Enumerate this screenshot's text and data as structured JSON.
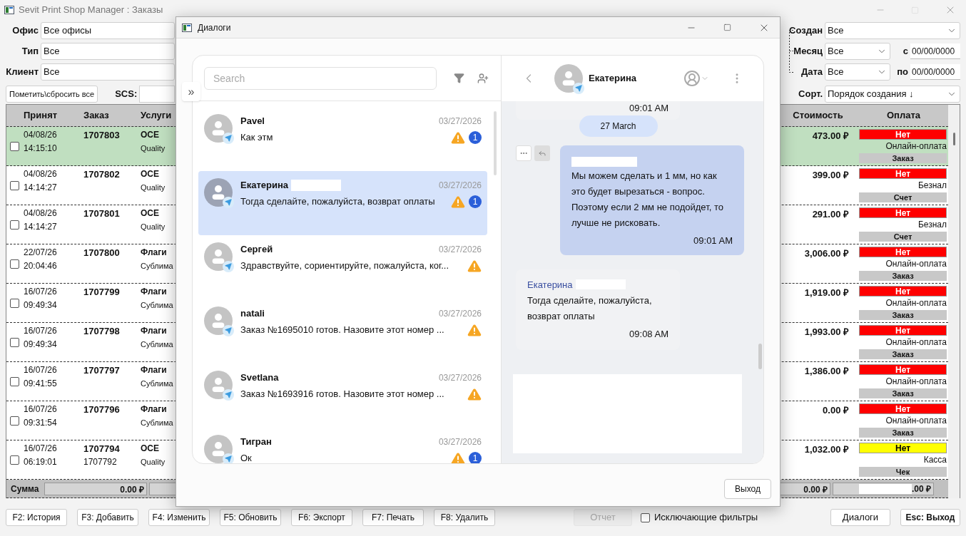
{
  "window": {
    "title": "Sevit Print Shop Manager : Заказы"
  },
  "filters_left": [
    {
      "label": "Офис",
      "value": "Все офисы"
    },
    {
      "label": "Тип",
      "value": "Все"
    },
    {
      "label": "Клиент",
      "value": "Все"
    }
  ],
  "mark_all_button": "Пометить\\сбросить все",
  "scs": {
    "label": "SCS:"
  },
  "filters_right": {
    "created": {
      "label": "Создан",
      "value": "Все"
    },
    "month": {
      "label": "Месяц",
      "value": "Все"
    },
    "date": {
      "label": "Дата",
      "value": "Все"
    },
    "from": {
      "label": "с",
      "value": "00/00/0000"
    },
    "to": {
      "label": "по",
      "value": "00/00/0000"
    },
    "sort": {
      "label": "Сорт.",
      "value": "Порядок создания ↓"
    }
  },
  "table": {
    "columns": [
      "Принят",
      "Заказ",
      "Услуги",
      "Стоимость",
      "Оплата"
    ],
    "rows": [
      {
        "selected": true,
        "checked": false,
        "date": "04/08/26",
        "time": "14:15:10",
        "order": "1707803",
        "service": "OCE",
        "service_sub": "Quality",
        "cost": "473.00 ₽",
        "status": "Нет",
        "color": "#ff0000",
        "method": "Онлайн-оплата",
        "doc": "Заказ"
      },
      {
        "selected": false,
        "checked": false,
        "date": "04/08/26",
        "time": "14:14:27",
        "order": "1707802",
        "service": "OCE",
        "service_sub": "Quality",
        "cost": "399.00 ₽",
        "status": "Нет",
        "color": "#ff0000",
        "method": "Безнал",
        "doc": "Счет"
      },
      {
        "selected": false,
        "checked": false,
        "date": "04/08/26",
        "time": "14:14:27",
        "order": "1707801",
        "service": "OCE",
        "service_sub": "Quality",
        "cost": "291.00 ₽",
        "status": "Нет",
        "color": "#ff0000",
        "method": "Безнал",
        "doc": "Счет"
      },
      {
        "selected": false,
        "checked": false,
        "date": "22/07/26",
        "time": "20:04:46",
        "order": "1707800",
        "service": "Флаги",
        "service_sub": "Сублима",
        "cost": "3,006.00 ₽",
        "status": "Нет",
        "color": "#ff0000",
        "method": "Онлайн-оплата",
        "doc": "Заказ"
      },
      {
        "selected": false,
        "checked": false,
        "date": "16/07/26",
        "time": "09:49:34",
        "order": "1707799",
        "service": "Флаги",
        "service_sub": "Сублима",
        "cost": "1,919.00 ₽",
        "status": "Нет",
        "color": "#ff0000",
        "method": "Онлайн-оплата",
        "doc": "Заказ"
      },
      {
        "selected": false,
        "checked": false,
        "date": "16/07/26",
        "time": "09:49:34",
        "order": "1707798",
        "service": "Флаги",
        "service_sub": "Сублима",
        "cost": "1,993.00 ₽",
        "status": "Нет",
        "color": "#ff0000",
        "method": "Онлайн-оплата",
        "doc": "Заказ"
      },
      {
        "selected": false,
        "checked": false,
        "date": "16/07/26",
        "time": "09:41:55",
        "order": "1707797",
        "service": "Флаги",
        "service_sub": "Сублима",
        "cost": "1,386.00 ₽",
        "status": "Нет",
        "color": "#ff0000",
        "method": "Онлайн-оплата",
        "doc": "Заказ"
      },
      {
        "selected": false,
        "checked": false,
        "date": "16/07/26",
        "time": "09:31:54",
        "order": "1707796",
        "service": "Флаги",
        "service_sub": "Сублима",
        "cost": "0.00 ₽",
        "status": "Нет",
        "color": "#ff0000",
        "method": "Онлайн-оплата",
        "doc": "Заказ"
      },
      {
        "selected": false,
        "checked": false,
        "date": "16/07/26",
        "time": "06:19:01",
        "order": "1707794",
        "order_sub": "1707792",
        "service": "OCE",
        "service_sub": "Quality",
        "cost": "1,032.00 ₽",
        "status": "Нет",
        "color": "#ffff00",
        "method": "Касса",
        "doc": "Чек"
      }
    ],
    "sum": {
      "label": "Сумма",
      "left_value": "0.00 ₽",
      "right_values": [
        "0.00 ₽",
        ".00 ₽"
      ]
    }
  },
  "bottom_buttons": [
    {
      "label": "F2: История",
      "disabled": false
    },
    {
      "label": "F3: Добавить",
      "disabled": false
    },
    {
      "label": "F4: Изменить",
      "disabled": false
    },
    {
      "label": "F5: Обновить",
      "disabled": false
    },
    {
      "label": "F6: Экспорт",
      "disabled": false
    },
    {
      "label": "F7: Печать",
      "disabled": false
    },
    {
      "label": "F8: Удалить",
      "disabled": false
    }
  ],
  "report_button": {
    "label": "Отчет",
    "disabled": true
  },
  "exclusive_filters": {
    "label": "Исключающие фильтры",
    "checked": false
  },
  "dialogs_button": "Диалоги",
  "exit_button": "Esc: Выход",
  "dialog": {
    "title": "Диалоги",
    "expand": "»",
    "search": {
      "placeholder": "Search"
    },
    "conversations": [
      {
        "name": "Pavel",
        "redacted": false,
        "date": "03/27/2026",
        "preview": "Как этм",
        "warning": true,
        "unread": "1",
        "selected": false
      },
      {
        "name": "Екатерина",
        "redacted": true,
        "date": "03/27/2026",
        "preview": "Тогда сделайте, пожалуйста, возврат оплаты",
        "warning": true,
        "unread": "1",
        "selected": true
      },
      {
        "name": "Сергей",
        "redacted": false,
        "date": "03/27/2026",
        "preview": "Здравствуйте, сориентируйте, пожалуйста, ког...",
        "warning": true,
        "selected": false
      },
      {
        "name": "natali",
        "redacted": false,
        "date": "03/27/2026",
        "preview": "Заказ №1695010 готов. Назовите этот номер ...",
        "warning": true,
        "selected": false
      },
      {
        "name": "Svetlana",
        "redacted": false,
        "date": "03/27/2026",
        "preview": "Заказ №1693916 готов. Назовите этот номер ...",
        "warning": true,
        "selected": false
      },
      {
        "name": "Тигран",
        "redacted": false,
        "date": "03/27/2026",
        "preview": "Ок",
        "warning": true,
        "unread": "1",
        "selected": false
      }
    ],
    "chat": {
      "name": "Екатерина",
      "messages": [
        {
          "kind": "incoming-tail",
          "time": "09:01 AM"
        },
        {
          "kind": "date",
          "text": "27 March"
        },
        {
          "kind": "outgoing",
          "redacted_sender": true,
          "text": "Мы можем сделать и 1 мм, но как это будет вырезаться - вопрос. Поэтому если 2 мм не подойдет, то лучше не рисковать.",
          "time": "09:01 AM"
        },
        {
          "kind": "incoming",
          "sender": "Екатерина",
          "redacted_sender": true,
          "text": "Тогда сделайте, пожалуйста, возврат оплаты",
          "time": "09:08 AM"
        }
      ]
    },
    "footer_button": "Выход"
  }
}
